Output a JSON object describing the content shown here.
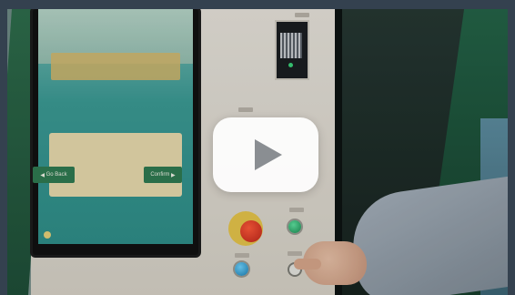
{
  "kiosk_screen": {
    "back_label": "Go Back",
    "confirm_label": "Confirm"
  },
  "icons": {
    "play": "play-icon",
    "back": "arrow-left-icon",
    "confirm": "arrow-right-icon"
  },
  "colors": {
    "play_button": "#ffffff",
    "play_triangle": "#8a8e92",
    "kiosk_green": "#2f7b52",
    "estop_red": "#c0261a"
  }
}
